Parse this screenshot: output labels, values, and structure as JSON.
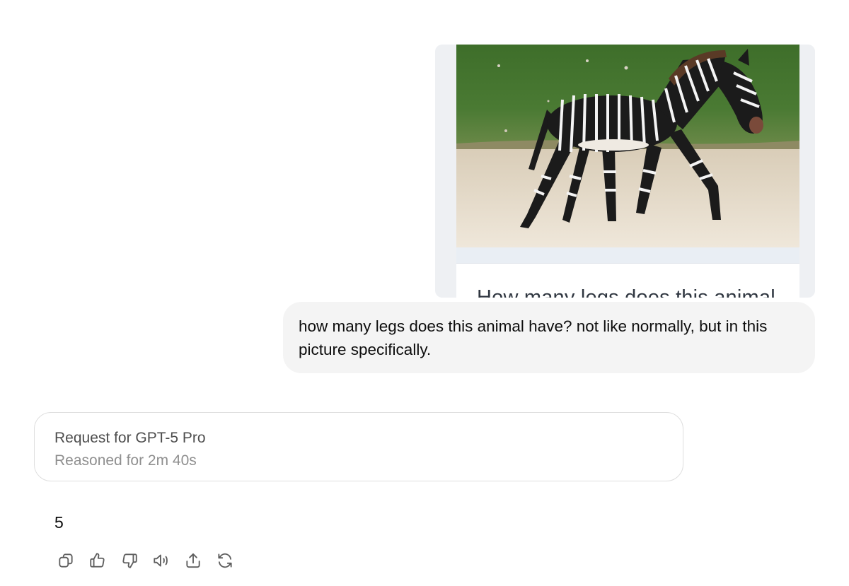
{
  "attachment": {
    "image_alt": "zebra walking on sand",
    "caption": "How many legs does this animal"
  },
  "user_message": {
    "text": "how many legs does this animal have? not like normally, but in this picture specifically."
  },
  "reasoning": {
    "title": "Request for GPT-5 Pro",
    "subtitle": "Reasoned for 2m 40s"
  },
  "answer": {
    "text": "5"
  },
  "actions": [
    {
      "name": "copy-button",
      "icon": "copy-icon"
    },
    {
      "name": "thumbs-up-button",
      "icon": "thumbs-up-icon"
    },
    {
      "name": "thumbs-down-button",
      "icon": "thumbs-down-icon"
    },
    {
      "name": "read-aloud-button",
      "icon": "speaker-icon"
    },
    {
      "name": "share-button",
      "icon": "share-icon"
    },
    {
      "name": "regenerate-button",
      "icon": "refresh-icon"
    }
  ],
  "colors": {
    "bubble_bg": "#f4f4f4",
    "card_border": "#dedede",
    "icon": "#5d5d5d"
  }
}
